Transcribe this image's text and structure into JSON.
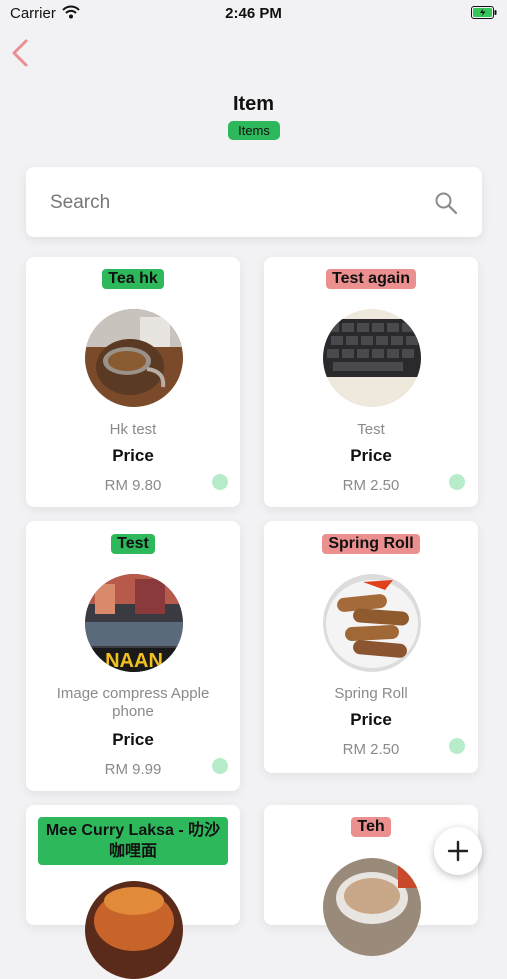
{
  "status_bar": {
    "carrier": "Carrier",
    "time": "2:46 PM"
  },
  "header": {
    "title": "Item",
    "badge": "Items"
  },
  "search": {
    "placeholder": "Search"
  },
  "items": [
    {
      "name": "Tea hk",
      "description": "Hk test",
      "price_label": "Price",
      "price": "RM 9.80"
    },
    {
      "name": "Test again",
      "description": "Test",
      "price_label": "Price",
      "price": "RM 2.50"
    },
    {
      "name": "Test",
      "description": "Image compress Apple phone",
      "price_label": "Price",
      "price": "RM 9.99"
    },
    {
      "name": "Spring Roll",
      "description": "Spring Roll",
      "price_label": "Price",
      "price": "RM 2.50"
    },
    {
      "name": "Mee Curry Laksa - 叻沙咖哩面"
    },
    {
      "name": "Teh"
    }
  ],
  "colors": {
    "accent_green": "#2eb85c",
    "accent_pink": "#ec8f8f",
    "back_arrow": "#ec8f8f",
    "status_dot": "#b6ecc9"
  },
  "icons": {
    "back": "chevron-left-icon",
    "search": "search-icon",
    "add": "plus-icon"
  }
}
